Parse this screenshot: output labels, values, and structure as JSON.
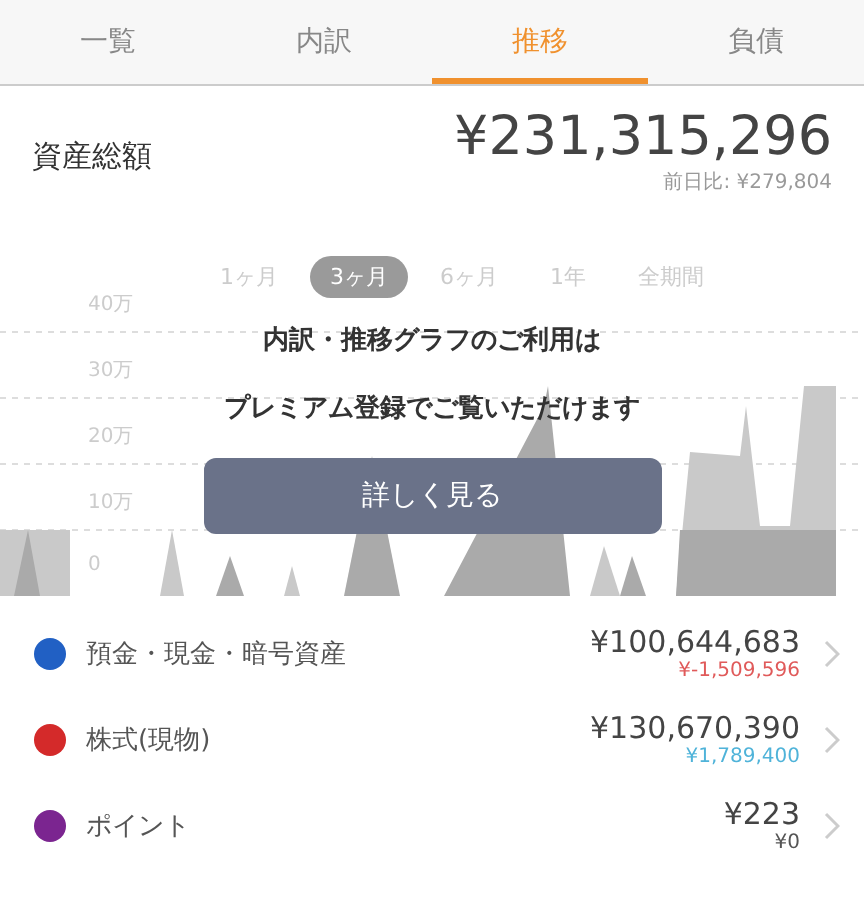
{
  "tabs": [
    {
      "label": "一覧",
      "selected": false
    },
    {
      "label": "内訳",
      "selected": false
    },
    {
      "label": "推移",
      "selected": true
    },
    {
      "label": "負債",
      "selected": false
    }
  ],
  "total": {
    "label": "資産総額",
    "amount": "¥231,315,296",
    "change": "前日比: ¥279,804"
  },
  "periods": [
    {
      "label": "1ヶ月",
      "selected": false
    },
    {
      "label": "3ヶ月",
      "selected": true
    },
    {
      "label": "6ヶ月",
      "selected": false
    },
    {
      "label": "1年",
      "selected": false
    },
    {
      "label": "全期間",
      "selected": false
    }
  ],
  "chart": {
    "y_axis_labels": [
      "40万",
      "30万",
      "20万",
      "10万",
      "0"
    ]
  },
  "premium_notice": {
    "lines": [
      "内訳・推移グラフのご利用は",
      "プレミアム登録でご覧いただけます"
    ],
    "button": "詳しく見る"
  },
  "categories": [
    {
      "name": "預金・現金・暗号資産",
      "color": "#2160c4",
      "amount": "¥100,644,683",
      "change": "¥-1,509,596",
      "kind": "negative"
    },
    {
      "name": "株式(現物)",
      "color": "#d42a2a",
      "amount": "¥130,670,390",
      "change": "¥1,789,400",
      "kind": "positive"
    },
    {
      "name": "ポイント",
      "color": "#7b2590",
      "amount": "¥223",
      "change": "¥0",
      "kind": "neutral"
    }
  ]
}
